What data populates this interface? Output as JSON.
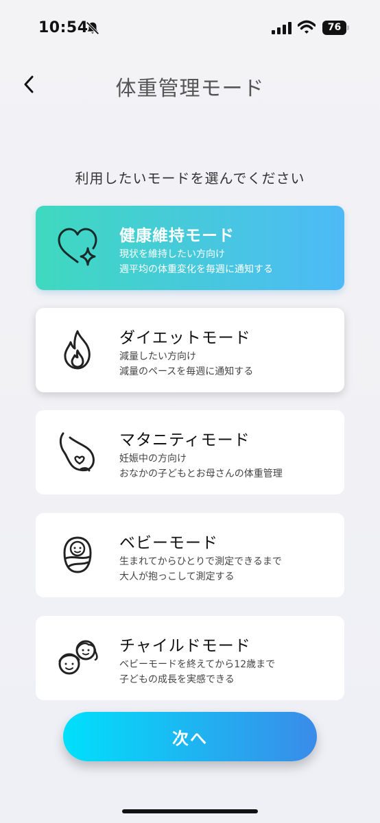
{
  "status_bar": {
    "time": "10:54",
    "battery": "76",
    "icons": [
      "bell-slash-icon",
      "cellular-signal-icon",
      "wifi-icon",
      "battery-icon"
    ]
  },
  "header": {
    "title": "体重管理モード",
    "back_icon": "chevron-left-icon"
  },
  "instruction": "利用したいモードを選んでください",
  "modes": [
    {
      "title": "健康維持モード",
      "desc1": "現状を維持したい方向け",
      "desc2": "週平均の体重変化を毎週に通知する",
      "icon": "heart-sparkle-icon",
      "selected": true
    },
    {
      "title": "ダイエットモード",
      "desc1": "減量したい方向け",
      "desc2": "減量のペースを毎週に通知する",
      "icon": "flame-icon",
      "selected": false
    },
    {
      "title": "マタニティモード",
      "desc1": "妊娠中の方向け",
      "desc2": "おなかの子どもとお母さんの体重管理",
      "icon": "pregnancy-icon",
      "selected": false
    },
    {
      "title": "ベビーモード",
      "desc1": "生まれてからひとりで測定できるまで",
      "desc2": "大人が抱っこして測定する",
      "icon": "swaddled-baby-icon",
      "selected": false
    },
    {
      "title": "チャイルドモード",
      "desc1": "ベビーモードを終えてから12歳まで",
      "desc2": "子どもの成長を実感できる",
      "icon": "children-icon",
      "selected": false
    }
  ],
  "next_button": {
    "label": "次へ"
  },
  "colors": {
    "selected_gradient_start": "#3fd9bf",
    "selected_gradient_end": "#4dbaf7",
    "button_gradient_start": "#00e0fb",
    "button_gradient_end": "#3a8be8"
  }
}
